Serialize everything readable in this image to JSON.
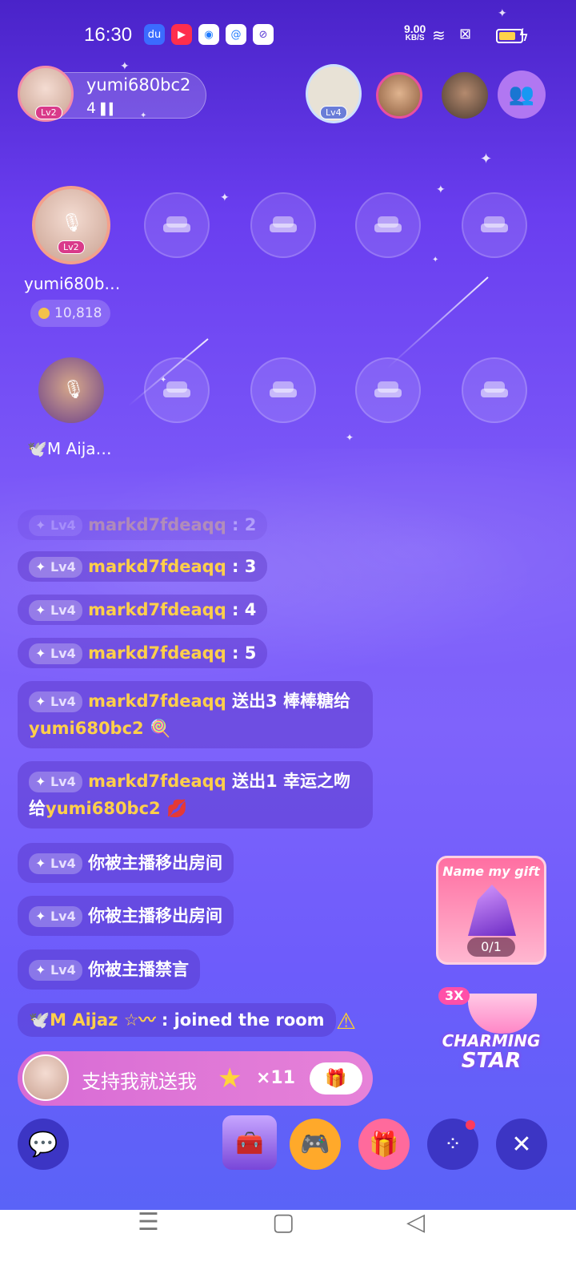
{
  "status_bar": {
    "time": "16:30",
    "net_speed": "9.00",
    "net_unit": "KB/S",
    "icons": [
      "baidu-app-icon",
      "video-app-icon",
      "browser-app-icon",
      "at-app-icon",
      "shield-app-icon",
      "wifi-icon",
      "sim-icon",
      "battery-icon",
      "charging-icon"
    ]
  },
  "host": {
    "name": "yumi680bc2",
    "level": "Lv2",
    "count": "4"
  },
  "header": {
    "rank_level": "Lv4"
  },
  "seats": {
    "seat1_name": "yumi680b…",
    "seat1_level": "Lv2",
    "seat1_coins": "10,818",
    "seat2_name": "🕊️M  Aija…"
  },
  "chat": {
    "faded_user": "markd7fdeaqq",
    "faded_value": ": 2",
    "messages": [
      {
        "level": "Lv4",
        "user": "markd7fdeaqq",
        "text": ": 3"
      },
      {
        "level": "Lv4",
        "user": "markd7fdeaqq",
        "text": ": 4"
      },
      {
        "level": "Lv4",
        "user": "markd7fdeaqq",
        "text": ": 5"
      }
    ],
    "gift1": {
      "level": "Lv4",
      "user": "markd7fdeaqq",
      "text": " 送出3 棒棒糖给",
      "target": "yumi680bc2",
      "emoji": "🍭"
    },
    "gift2": {
      "level": "Lv4",
      "user": "markd7fdeaqq",
      "text": " 送出1 幸运之吻",
      "prefix2": "给",
      "target": "yumi680bc2",
      "emoji": "💋"
    },
    "system": [
      {
        "level": "Lv4",
        "text": "你被主播移出房间"
      },
      {
        "level": "Lv4",
        "text": "你被主播移出房间"
      },
      {
        "level": "Lv4",
        "text": "你被主播禁言"
      }
    ],
    "joined": {
      "prefix": "🕊️M",
      "user": "Aijaz ☆〰",
      "text": ": joined the room"
    }
  },
  "promo": {
    "text": "支持我就送我",
    "count": "×11"
  },
  "side": {
    "gift_title": "Name my gift",
    "gift_progress": "0/1",
    "charm_multiplier": "3X",
    "charm_line1": "CHARMING",
    "charm_line2": "STAR"
  },
  "colors": {
    "accent_gold": "#ffcf4a",
    "bg_top": "#4a23c9",
    "bg_bottom": "#5a63f7"
  }
}
